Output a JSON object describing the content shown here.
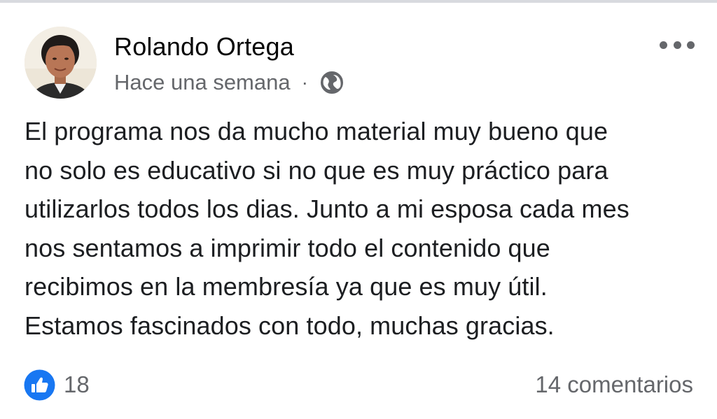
{
  "post": {
    "author": "Rolando Ortega",
    "timestamp": "Hace una semana",
    "separator": "·",
    "privacy_icon": "globe-icon",
    "text": "El programa nos da mucho material muy bueno que\nno solo es educativo si no que es muy práctico para\nutilizarlos todos los dias. Junto a mi esposa cada mes\nnos sentamos a imprimir todo el contenido que\nrecibimos en la membresía ya que es muy útil.\nEstamos fascinados con todo, muchas gracias.",
    "reaction_count": "18",
    "comment_count": "14 comentarios"
  },
  "colors": {
    "like_blue": "#1877f2",
    "secondary_text": "#65676b",
    "primary_text": "#1c1e21"
  }
}
